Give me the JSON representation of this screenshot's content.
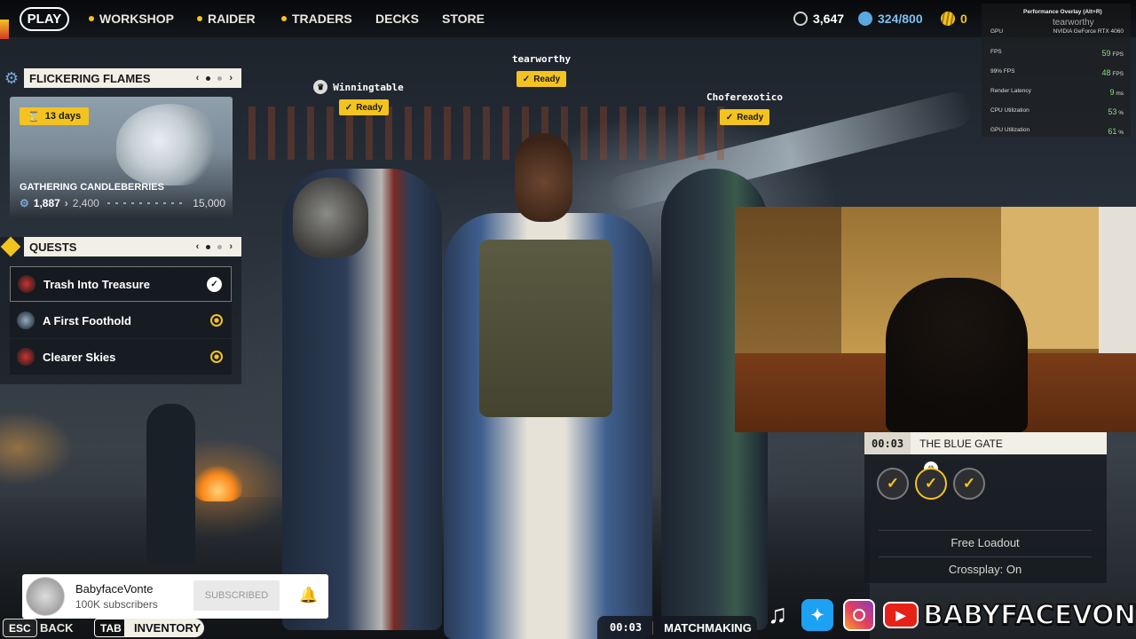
{
  "nav": {
    "play": "PLAY",
    "items": [
      "WORKSHOP",
      "RAIDER",
      "TRADERS",
      "DECKS",
      "STORE"
    ],
    "currencies": [
      {
        "icon": "coin-icon",
        "value": "3,647",
        "color": "#cfcfcf"
      },
      {
        "icon": "raider-token-icon",
        "value": "324/800",
        "color": "#5aa8e0"
      },
      {
        "icon": "cred-icon",
        "value": "0",
        "color": "#f3c320"
      }
    ]
  },
  "perf": {
    "title": "Performance Overlay (Alt+R)",
    "username": "tearworthy",
    "gpu_label": "GPU",
    "gpu_name": "NVIDIA GeForce RTX 4060",
    "rows": [
      {
        "label": "FPS",
        "value": "59",
        "unit": "FPS"
      },
      {
        "label": "99% FPS",
        "value": "48",
        "unit": "FPS"
      },
      {
        "label": "Render Latency",
        "value": "9",
        "unit": "ms"
      },
      {
        "label": "CPU Utilization",
        "value": "53",
        "unit": "%"
      },
      {
        "label": "GPU Utilization",
        "value": "61",
        "unit": "%"
      }
    ]
  },
  "event": {
    "header": "FLICKERING FLAMES",
    "timer": "13 days",
    "title": "GATHERING CANDLEBERRIES",
    "progress": "1,887",
    "next_tier": "2,400",
    "max_tier": "15,000",
    "progress_fraction": 0.126
  },
  "quests": {
    "header": "QUESTS",
    "items": [
      {
        "label": "Trash Into Treasure",
        "status": "complete"
      },
      {
        "label": "A First Foothold",
        "status": "active"
      },
      {
        "label": "Clearer Skies",
        "status": "active"
      }
    ]
  },
  "players": [
    {
      "name": "Winningtable",
      "status": "Ready",
      "leader": true
    },
    {
      "name": "tearworthy",
      "status": "Ready",
      "leader": false
    },
    {
      "name": "Choferexotico",
      "status": "Ready",
      "leader": false
    }
  ],
  "lobby": {
    "timer": "00:03",
    "map": "THE BLUE GATE",
    "options": [
      "Free Loadout",
      "Crossplay: On"
    ]
  },
  "subscribe": {
    "channel": "BabyfaceVonte",
    "subs": "100K subscribers",
    "button": "SUBSCRIBED"
  },
  "bottom": {
    "esc_key": "ESC",
    "esc_label": "BACK",
    "tab_key": "TAB",
    "tab_label": "INVENTORY",
    "mm_timer": "00:03",
    "mm_label": "MATCHMAKING"
  },
  "socials": {
    "handle": "BABYFACEVONTE",
    "icons": [
      "tiktok-icon",
      "twitter-icon",
      "instagram-icon",
      "youtube-icon"
    ]
  }
}
